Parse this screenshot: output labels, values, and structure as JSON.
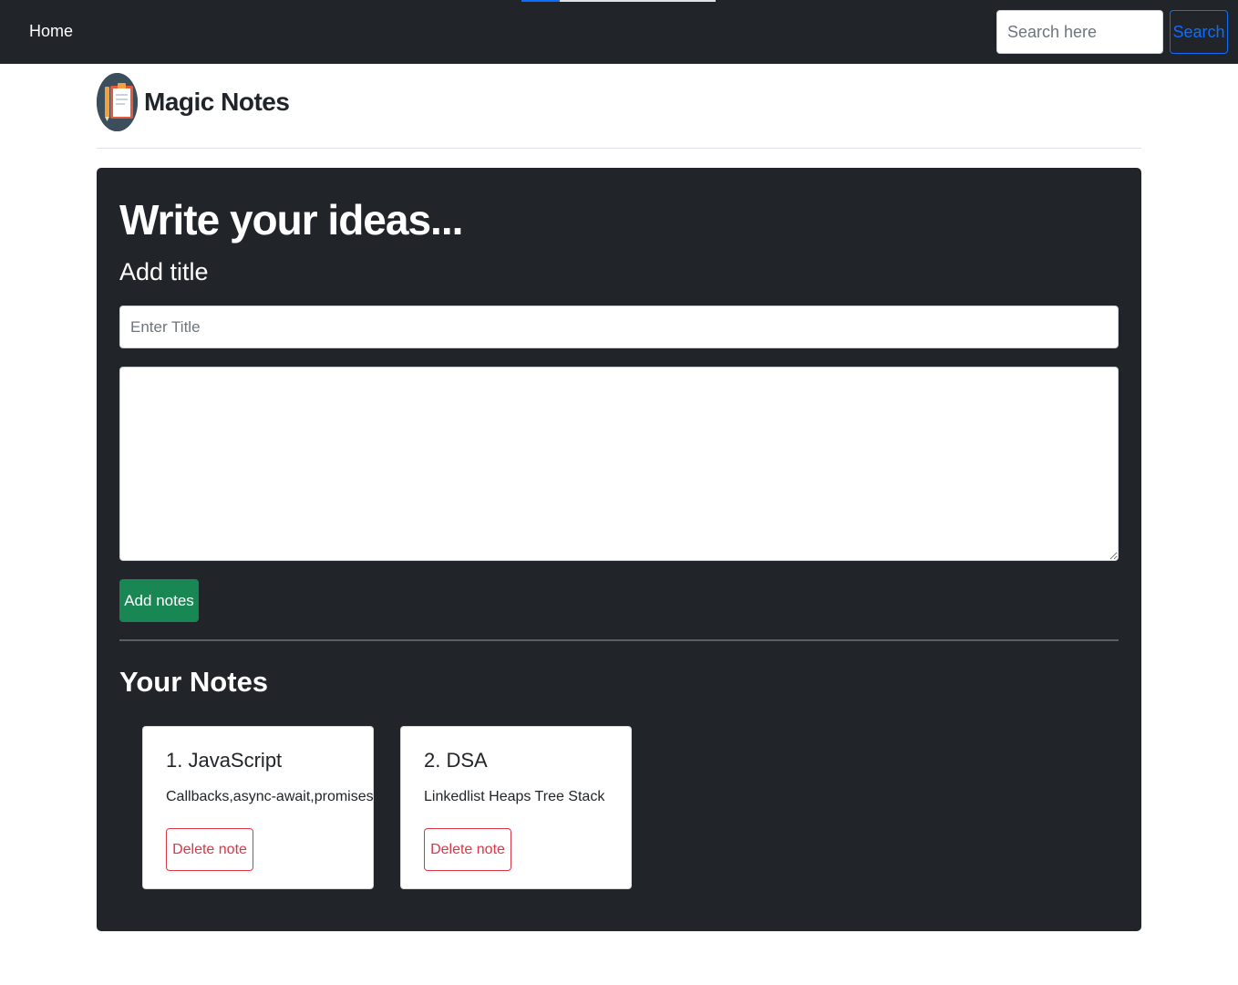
{
  "navbar": {
    "home_label": "Home",
    "search_placeholder": "Search here",
    "search_button_label": "Search"
  },
  "brand": {
    "title": "Magic Notes",
    "logo_icon": "clipboard-icon"
  },
  "composer": {
    "heading": "Write your ideas...",
    "title_label": "Add title",
    "title_placeholder": "Enter Title",
    "text_value": "",
    "add_button_label": "Add notes"
  },
  "notes_section": {
    "heading": "Your Notes",
    "notes": [
      {
        "title": "1. JavaScript",
        "text": "Callbacks,async-await,promises",
        "delete_label": "Delete note"
      },
      {
        "title": "2. DSA",
        "text": "Linkedlist Heaps Tree Stack",
        "delete_label": "Delete note"
      }
    ]
  },
  "colors": {
    "dark_bg": "#212529",
    "primary": "#0d6efd",
    "success": "#198754",
    "danger": "#dc3545"
  }
}
